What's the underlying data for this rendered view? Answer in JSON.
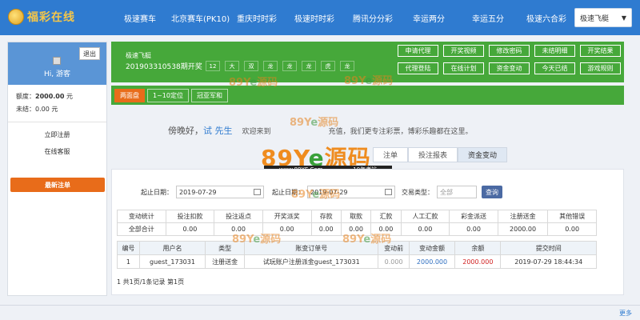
{
  "header": {
    "logo_text": "福彩在线",
    "nav": [
      "极速赛车",
      "北京赛车(PK10)",
      "重庆时时彩",
      "极速时时彩",
      "腾讯分分彩",
      "幸运两分",
      "幸运五分",
      "极速六合彩"
    ],
    "selected_game": "极速飞艇"
  },
  "sidebar": {
    "logout_label": "退出",
    "greeting": "Hi, 游客",
    "balance_label": "额度：",
    "balance_value": "2000.00",
    "balance_unit": "元",
    "unsettled_label": "未结：",
    "unsettled_value": "0.00",
    "unsettled_unit": "元",
    "links": [
      "立即注册",
      "在线客服"
    ],
    "latest_bets_label": "最新注单"
  },
  "game": {
    "name": "极速飞艇",
    "issue": "201903310538期开奖",
    "results": [
      "12",
      "大",
      "双",
      "龙",
      "龙",
      "龙",
      "虎",
      "龙"
    ],
    "actions_row1": [
      "申请代理",
      "开奖视频",
      "修改密码",
      "未结明细",
      "开奖结果"
    ],
    "actions_row2": [
      "代理登陆",
      "在线计划",
      "资金变动",
      "今天已结",
      "游戏规则"
    ]
  },
  "play_tabs": [
    "两面盘",
    "1~10定位",
    "冠亚军和"
  ],
  "greeting": {
    "prefix": "傍晚好，",
    "name": "试 先生",
    "message": "欢迎来到",
    "message_tail": "充值，我们更专注彩票，博彩乐趣都在这里。"
  },
  "watermark": {
    "text_a": "89Y",
    "text_b": "e",
    "text_c": "源码",
    "url": "www.89YE.Com",
    "sub": "10年老站"
  },
  "record_tabs": [
    "注单",
    "投注报表",
    "资金变动"
  ],
  "filter": {
    "start_label": "起止日期：",
    "start_value": "2019-07-29",
    "end_label": "起止日期：",
    "end_value": "2019-07-29",
    "type_label": "交易类型：",
    "type_placeholder": "全部",
    "query_label": "查询"
  },
  "summary": {
    "headers": [
      "变动统计",
      "投注扣款",
      "投注返点",
      "开奖派奖",
      "存款",
      "取款",
      "汇款",
      "人工汇款",
      "彩金派送",
      "注册送金",
      "其他错误"
    ],
    "row": [
      "全部合计",
      "0.00",
      "0.00",
      "0.00",
      "0.00",
      "0.00",
      "0.00",
      "0.00",
      "0.00",
      "2000.00",
      "0.00"
    ]
  },
  "records": {
    "headers": [
      "编号",
      "用户名",
      "类型",
      "账变订单号",
      "变动前",
      "变动金额",
      "余额",
      "提交时间"
    ],
    "rows": [
      [
        "1",
        "guest_173031",
        "注册送金",
        "试玩账户注册派金guest_173031",
        "0.000",
        "2000.000",
        "2000.000",
        "2019-07-29 18:44:34"
      ]
    ]
  },
  "pager": "1 共1页/1条记录 第1页",
  "footer": {
    "more": "更多"
  }
}
